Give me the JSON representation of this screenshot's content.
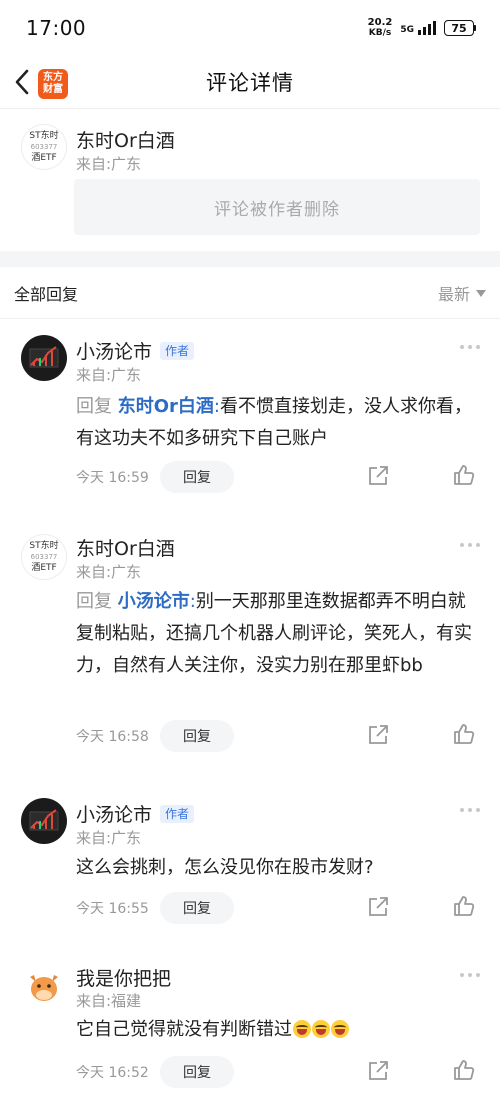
{
  "status_bar": {
    "time": "17:00",
    "net_speed_value": "20.2",
    "net_speed_unit": "KB/s",
    "network": "5G",
    "battery": "75"
  },
  "nav": {
    "title": "评论详情",
    "logo_line1": "东方",
    "logo_line2": "财富",
    "accent": "#f05a1a"
  },
  "main_comment": {
    "avatar_line1": "ST东时",
    "avatar_code": "603377",
    "avatar_line2": "酒ETF",
    "name": "东时Or白酒",
    "location": "来自:广东",
    "deleted_text": "评论被作者删除"
  },
  "replies_header": {
    "title": "全部回复",
    "sort_label": "最新"
  },
  "replies": [
    {
      "name": "小汤论市",
      "badge": "作者",
      "location": "来自:广东",
      "prefix": "回复",
      "mention": "东时Or白酒",
      "colon": ":",
      "text": "看不惯直接划走，没人求你看，有这功夫不如多研究下自己账户",
      "time": "今天 16:59",
      "reply_label": "回复"
    },
    {
      "name": "东时Or白酒",
      "avatar_line1": "ST东时",
      "avatar_code": "603377",
      "avatar_line2": "酒ETF",
      "location": "来自:广东",
      "prefix": "回复",
      "mention": "小汤论市",
      "colon": ":",
      "text": "别一天那那里连数据都弄不明白就复制粘贴，还搞几个机器人刷评论，笑死人，有实力，自然有人关注你，没实力别在那里虾bb",
      "time": "今天 16:58",
      "reply_label": "回复"
    },
    {
      "name": "小汤论市",
      "badge": "作者",
      "location": "来自:广东",
      "text": "这么会挑刺，怎么没见你在股市发财?",
      "time": "今天 16:55",
      "reply_label": "回复"
    },
    {
      "name": "我是你把把",
      "location": "来自:福建",
      "text": "它自己觉得就没有判断错过",
      "time": "今天 16:52",
      "reply_label": "回复"
    }
  ],
  "colors": {
    "mention": "#2d6cc4",
    "badge_bg": "#e8f0fd",
    "muted": "#999999",
    "section_bg": "#f4f5f7"
  }
}
